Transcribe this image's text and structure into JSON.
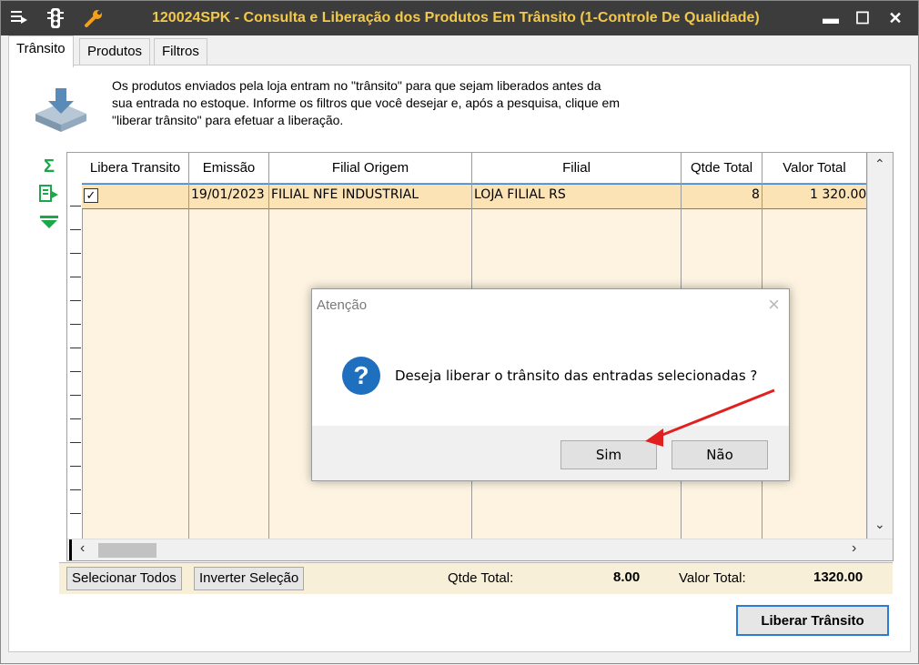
{
  "window": {
    "title": "120024SPK - Consulta e Liberação dos Produtos Em Trânsito (1-Controle De Qualidade)",
    "minimize": "▬",
    "maximize": "☐",
    "close": "✕"
  },
  "titlebar_icons": [
    "menu-icon",
    "traffic-light-icon",
    "wrench-icon"
  ],
  "tabs": [
    {
      "label": "Trânsito",
      "active": true
    },
    {
      "label": "Produtos",
      "active": false
    },
    {
      "label": "Filtros",
      "active": false
    }
  ],
  "info_text": "Os produtos enviados pela loja entram no \"trânsito\" para que sejam liberados antes da sua entrada no estoque. Informe os filtros que você desejar e, após a pesquisa, clique em \"liberar trânsito\" para efetuar a liberação.",
  "side_icons": [
    "sum-icon",
    "export-icon",
    "filter-icon"
  ],
  "grid": {
    "columns": [
      "Libera Transito",
      "Emissão",
      "Filial Origem",
      "Filial",
      "Qtde Total",
      "Valor Total"
    ],
    "rows": [
      {
        "libera": true,
        "emissao": "19/01/2023",
        "filial_origem": "FILIAL NFE INDUSTRIAL",
        "filial": "LOJA FILIAL RS",
        "qtde_total": "8",
        "valor_total": "1 320.00"
      }
    ]
  },
  "footer": {
    "select_all": "Selecionar Todos",
    "invert_selection": "Inverter Seleção",
    "qtde_label": "Qtde Total:",
    "qtde_value": "8.00",
    "valor_label": "Valor Total:",
    "valor_value": "1320.00"
  },
  "liberar_button": "Liberar Trânsito",
  "dialog": {
    "title": "Atenção",
    "message": "Deseja liberar o trânsito das entradas selecionadas ?",
    "yes": "Sim",
    "no": "Não",
    "icon": "question-icon"
  },
  "colors": {
    "title_text": "#f2c94c",
    "titlebar_bg": "#3c3c3c",
    "row_selected": "#fce3b6",
    "annotation_arrow": "#e02020"
  }
}
